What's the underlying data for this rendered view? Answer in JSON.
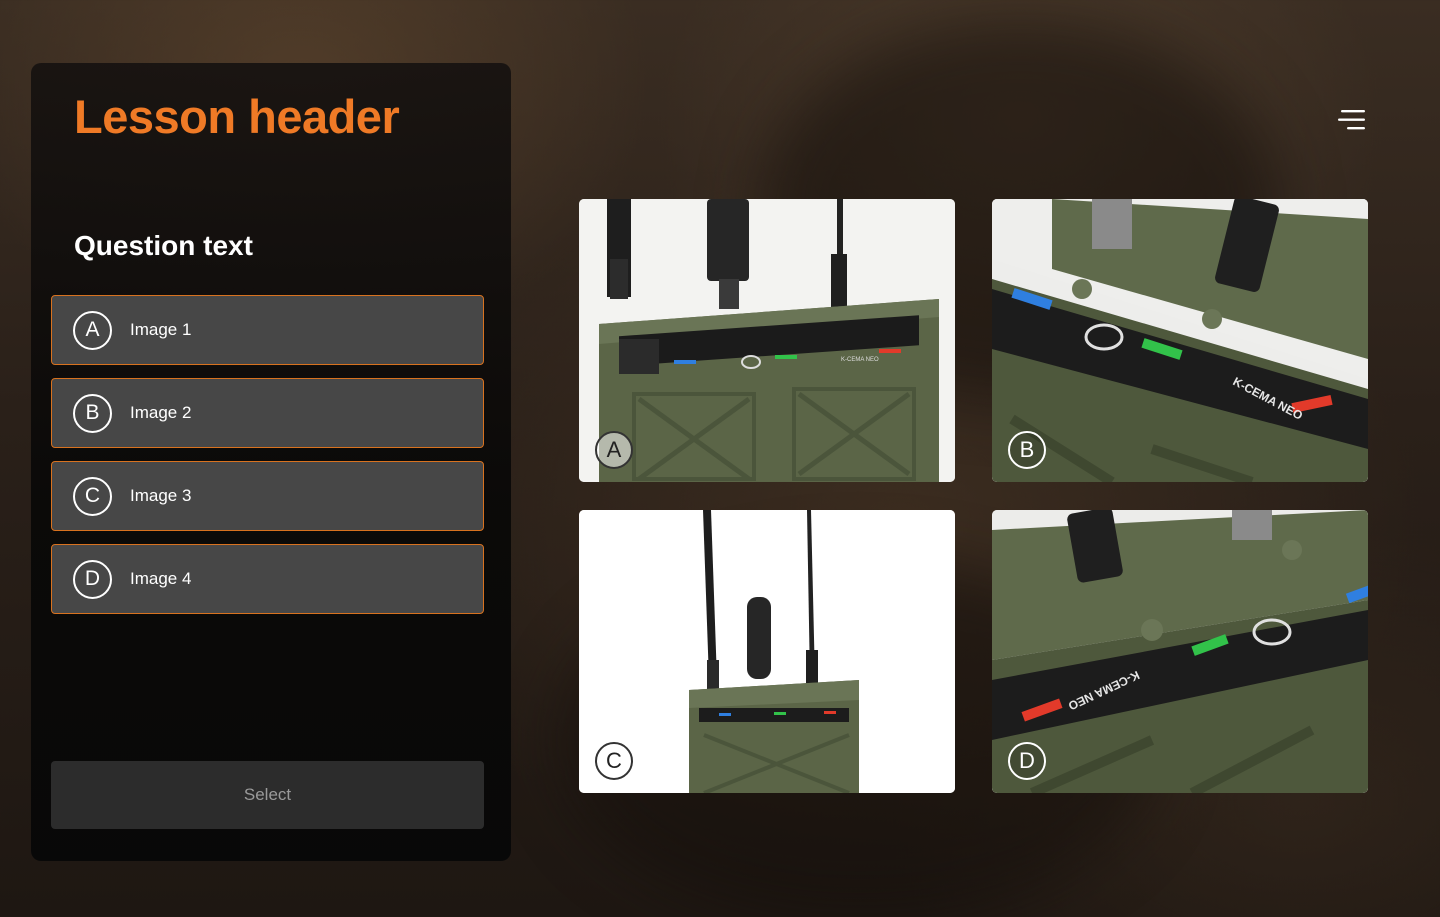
{
  "lesson": {
    "header": "Lesson header",
    "question": "Question text",
    "options": [
      {
        "letter": "A",
        "label": "Image 1"
      },
      {
        "letter": "B",
        "label": "Image 2"
      },
      {
        "letter": "C",
        "label": "Image 3"
      },
      {
        "letter": "D",
        "label": "Image 4"
      }
    ],
    "select_label": "Select"
  },
  "images": [
    {
      "letter": "A",
      "device_label": "K-CEMA NEO"
    },
    {
      "letter": "B",
      "device_label": "K-CEMA NEO"
    },
    {
      "letter": "C",
      "device_label": ""
    },
    {
      "letter": "D",
      "device_label": "K-CEMA NEO"
    }
  ],
  "icons": {
    "menu": "menu-icon"
  },
  "colors": {
    "accent": "#ef7a26",
    "option_border": "#d8721f",
    "option_bg": "#474747",
    "device_green": "#5b6547"
  }
}
